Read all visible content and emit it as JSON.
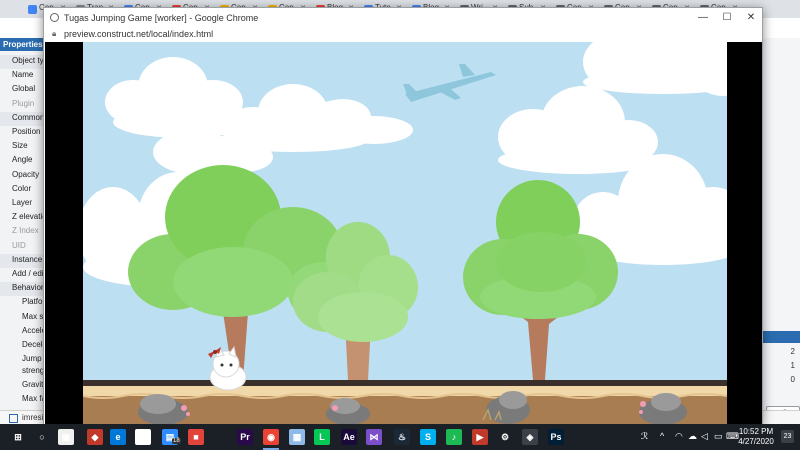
{
  "background_browser": {
    "tabs": [
      {
        "label": "Cop",
        "color": "#4285f4"
      },
      {
        "label": "Tran",
        "color": "#888888"
      },
      {
        "label": "Cop",
        "color": "#4285f4"
      },
      {
        "label": "Cop",
        "color": "#ea4335"
      },
      {
        "label": "Cop",
        "color": "#f4b400"
      },
      {
        "label": "Cop",
        "color": "#f4b400"
      },
      {
        "label": "Blog",
        "color": "#ea4335"
      },
      {
        "label": "Tuto",
        "color": "#4285f4"
      },
      {
        "label": "Blog",
        "color": "#4285f4"
      },
      {
        "label": "Wri",
        "color": "#666666"
      },
      {
        "label": "Sub",
        "color": "#666666"
      },
      {
        "label": "Cop",
        "color": "#666666"
      },
      {
        "label": "Cop",
        "color": "#666666"
      },
      {
        "label": "Cop",
        "color": "#666666"
      },
      {
        "label": "Cop",
        "color": "#666666"
      }
    ]
  },
  "properties_panel": {
    "header": "Properties",
    "rows": [
      {
        "label": "Object type",
        "kind": "section"
      },
      {
        "label": "Name",
        "kind": "row"
      },
      {
        "label": "Global",
        "kind": "row"
      },
      {
        "label": "Plugin",
        "kind": "grey"
      },
      {
        "label": "Common",
        "kind": "section"
      },
      {
        "label": "Position",
        "kind": "row"
      },
      {
        "label": "Size",
        "kind": "row"
      },
      {
        "label": "Angle",
        "kind": "row"
      },
      {
        "label": "Opacity",
        "kind": "row"
      },
      {
        "label": "Color",
        "kind": "row"
      },
      {
        "label": "Layer",
        "kind": "row"
      },
      {
        "label": "Z elevation",
        "kind": "row"
      },
      {
        "label": "Z Index",
        "kind": "grey"
      },
      {
        "label": "UID",
        "kind": "grey"
      },
      {
        "label": "Instance variables",
        "kind": "section"
      },
      {
        "label": "Add / edit",
        "kind": "row"
      },
      {
        "label": "Behaviors",
        "kind": "section"
      },
      {
        "label": "Platform",
        "kind": "sub"
      },
      {
        "label": "Max speed",
        "kind": "sub"
      },
      {
        "label": "Acceleration",
        "kind": "sub"
      },
      {
        "label": "Deceleration",
        "kind": "sub"
      },
      {
        "label": "Jump strength",
        "kind": "sub2"
      },
      {
        "label": "Gravity",
        "kind": "sub"
      },
      {
        "label": "Max fall speed",
        "kind": "sub"
      }
    ]
  },
  "right_pane": {
    "numbers": [
      "2",
      "1",
      "0"
    ],
    "button_label": "all"
  },
  "bottom_strip": {
    "text": "imresi"
  },
  "chrome_window": {
    "title": "Tugas Jumping Game [worker] - Google Chrome",
    "url": "preview.construct.net/local/index.html",
    "minimize": "—",
    "maximize": "☐",
    "close": "✕"
  },
  "game": {
    "scene": "cartoon park with clouds, airplane, trees, ground with rocks",
    "character": "white cat with red bow",
    "colors": {
      "sky": "#bcdff2",
      "ground_top": "#f0d8a8",
      "ground": "#a97d52",
      "tree": "#7fcf5a",
      "trunk": "#b67a5c"
    }
  },
  "taskbar": {
    "icons": [
      {
        "name": "windows-start-icon",
        "glyph": "⊞",
        "color": "#1b1f26"
      },
      {
        "name": "search-icon",
        "glyph": "○",
        "color": "#1b1f26"
      },
      {
        "name": "store-icon",
        "glyph": "▣",
        "color": "#f0f0f0"
      },
      {
        "name": "gaming-icon",
        "glyph": "◆",
        "color": "#c0392b"
      },
      {
        "name": "edge-icon",
        "glyph": "e",
        "color": "#0078d7"
      },
      {
        "name": "onedrive-icon",
        "glyph": "☁",
        "color": "#ffffff"
      },
      {
        "name": "photos-icon",
        "glyph": "▤",
        "color": "#2d8cff"
      },
      {
        "name": "screen-recorder-icon",
        "glyph": "■",
        "color": "#e0443b"
      },
      {
        "name": "premiere-icon",
        "glyph": "Pr",
        "color": "#2a0a4a"
      },
      {
        "name": "chrome-icon",
        "glyph": "◉",
        "color": "#ea4335"
      },
      {
        "name": "files-icon",
        "glyph": "▦",
        "color": "#8fb9e8"
      },
      {
        "name": "line-icon",
        "glyph": "L",
        "color": "#06c755"
      },
      {
        "name": "after-effects-icon",
        "glyph": "Ae",
        "color": "#1a0a3a"
      },
      {
        "name": "visual-studio-icon",
        "glyph": "⋈",
        "color": "#7b4fc9"
      },
      {
        "name": "steam-icon",
        "glyph": "♨",
        "color": "#1b2838"
      },
      {
        "name": "skype-icon",
        "glyph": "S",
        "color": "#00aff0"
      },
      {
        "name": "spotify-icon",
        "glyph": "♪",
        "color": "#1db954"
      },
      {
        "name": "media-player-icon",
        "glyph": "▶",
        "color": "#c0392b"
      },
      {
        "name": "settings-icon",
        "glyph": "⚙",
        "color": "#1b1f26"
      },
      {
        "name": "unknown-app-icon",
        "glyph": "◈",
        "color": "#3a3f48"
      },
      {
        "name": "photoshop-icon",
        "glyph": "Ps",
        "color": "#001e36"
      }
    ],
    "badge_onedrive": "18",
    "time": "10:52 PM",
    "date": "4/27/2020",
    "notifications": "23"
  }
}
